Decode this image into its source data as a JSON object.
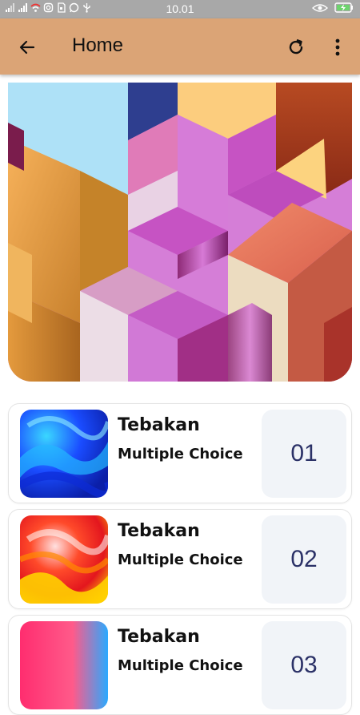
{
  "status_bar": {
    "time": "10.01",
    "left_icons": [
      "signal-off-icon",
      "signal-icon",
      "wifi-icon",
      "instagram-icon",
      "sim-icon",
      "whatsapp-icon",
      "usb-icon"
    ],
    "right_icons": [
      "eye-icon",
      "battery-charging-icon"
    ]
  },
  "app_bar": {
    "title": "Home",
    "back_icon": "arrow-left-icon",
    "refresh_icon": "refresh-icon",
    "more_icon": "more-vertical-icon",
    "background": "#dba476"
  },
  "banner": {
    "image": "isometric-cubes-banner"
  },
  "quizzes": [
    {
      "title": "Tebakan",
      "subtitle": "Multiple Choice",
      "number": "01",
      "thumbnail": "blue-fluid-thumbnail"
    },
    {
      "title": "Tebakan",
      "subtitle": "Multiple Choice",
      "number": "02",
      "thumbnail": "red-yellow-fluid-thumbnail"
    },
    {
      "title": "Tebakan",
      "subtitle": "Multiple Choice",
      "number": "03",
      "thumbnail": "pink-fluid-thumbnail"
    }
  ],
  "colors": {
    "accent": "#dba476",
    "number_text": "#2b3167",
    "number_bg": "#f1f4f8"
  }
}
